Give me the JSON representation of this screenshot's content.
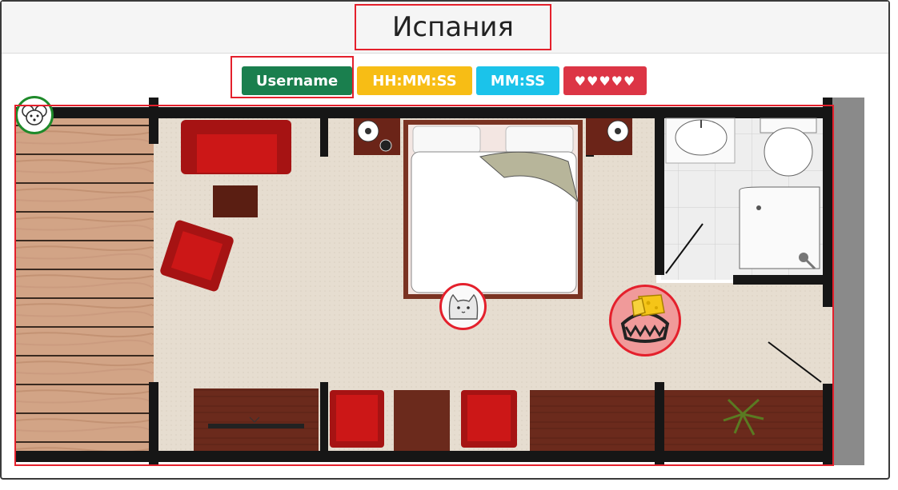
{
  "header": {
    "title": "Испания"
  },
  "status_bar": {
    "username": "Username",
    "timer_long": "HH:MM:SS",
    "timer_short": "MM:SS",
    "lives": "♥♥♥♥♥"
  },
  "colors": {
    "username_badge": "#1a7f4e",
    "timer_long_badge": "#f7bd15",
    "timer_short_badge": "#1bc3ea",
    "lives_badge": "#dc3545",
    "highlight_outline": "#e4202c",
    "mouse_ring": "#1f8a2a",
    "cat_ring": "#e4202c"
  },
  "game": {
    "player_icon": "mouse-icon",
    "enemy_icon": "cat-icon",
    "goal_icon": "cheese-trap-icon"
  }
}
